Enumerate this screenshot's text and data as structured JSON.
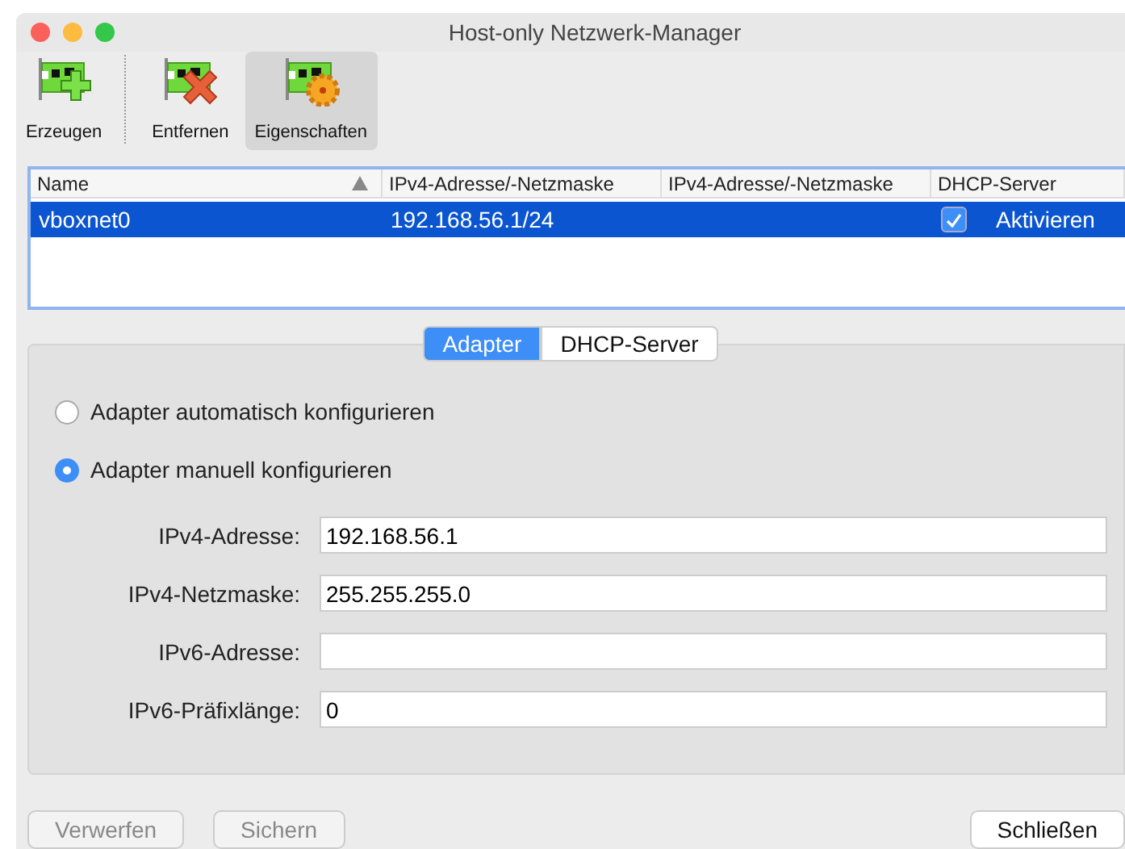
{
  "window": {
    "title": "Host-only Netzwerk-Manager"
  },
  "toolbar": [
    {
      "label": "Erzeugen",
      "kind": "add",
      "selected": false
    },
    {
      "label": "Entfernen",
      "kind": "remove",
      "selected": false
    },
    {
      "label": "Eigenschaften",
      "kind": "properties",
      "selected": true
    }
  ],
  "table": {
    "columns": [
      {
        "label": "Name",
        "sorted": true
      },
      {
        "label": "IPv4-Adresse/-Netzmaske",
        "sorted": false
      },
      {
        "label": "IPv4-Adresse/-Netzmaske",
        "sorted": false
      },
      {
        "label": "DHCP-Server",
        "sorted": false
      }
    ],
    "rows": [
      {
        "name": "vboxnet0",
        "ipv4": "192.168.56.1/24",
        "dhcp_checked": true,
        "dhcp_label": "Aktivieren",
        "selected": true
      }
    ]
  },
  "tabs": [
    {
      "label": "Adapter",
      "selected": true
    },
    {
      "label": "DHCP-Server",
      "selected": false
    }
  ],
  "options": [
    {
      "label": "Adapter automatisch konfigurieren",
      "selected": false
    },
    {
      "label": "Adapter manuell konfigurieren",
      "selected": true
    }
  ],
  "fields": [
    {
      "label": "IPv4-Adresse:",
      "value": "192.168.56.1"
    },
    {
      "label": "IPv4-Netzmaske:",
      "value": "255.255.255.0"
    },
    {
      "label": "IPv6-Adresse:"
    },
    {
      "label": "IPv6-Präfixlänge:",
      "value": "0"
    }
  ],
  "buttons": [
    {
      "label": "Verwerfen",
      "disabled": true
    },
    {
      "label": "Sichern",
      "disabled": true
    },
    {
      "label": "Schließen",
      "disabled": false
    }
  ]
}
